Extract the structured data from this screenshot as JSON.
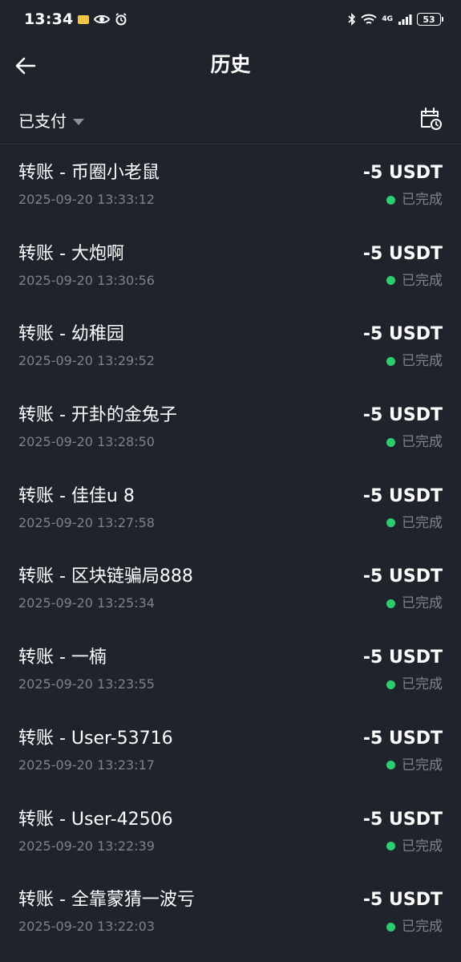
{
  "status_bar": {
    "time": "13:34",
    "network": "4G",
    "battery": "53",
    "icons": [
      "mail-icon",
      "eye-icon",
      "alarm-icon",
      "bluetooth-icon",
      "wifi-icon",
      "signal-icon",
      "battery-icon"
    ]
  },
  "header": {
    "title": "历史",
    "back_icon": "arrow-left-icon"
  },
  "filter": {
    "label": "已支付",
    "caret_icon": "caret-down-icon",
    "calendar_icon": "calendar-clock-icon"
  },
  "colors": {
    "background": "#1f242c",
    "text_primary": "#ffffff",
    "text_secondary": "#7d828b",
    "status_completed": "#2ecc71"
  },
  "transactions": [
    {
      "title": "转账 - 币圈小老鼠",
      "time": "2025-09-20 13:33:12",
      "amount": "-5 USDT",
      "status": "已完成"
    },
    {
      "title": "转账 - 大炮啊",
      "time": "2025-09-20 13:30:56",
      "amount": "-5 USDT",
      "status": "已完成"
    },
    {
      "title": "转账 - 幼稚园",
      "time": "2025-09-20 13:29:52",
      "amount": "-5 USDT",
      "status": "已完成"
    },
    {
      "title": "转账 - 开卦的金兔子",
      "time": "2025-09-20 13:28:50",
      "amount": "-5 USDT",
      "status": "已完成"
    },
    {
      "title": "转账 - 佳佳u 8",
      "time": "2025-09-20 13:27:58",
      "amount": "-5 USDT",
      "status": "已完成"
    },
    {
      "title": "转账 - 区块链骗局888",
      "time": "2025-09-20 13:25:34",
      "amount": "-5 USDT",
      "status": "已完成"
    },
    {
      "title": "转账 - 一楠",
      "time": "2025-09-20 13:23:55",
      "amount": "-5 USDT",
      "status": "已完成"
    },
    {
      "title": "转账 - User-53716",
      "time": "2025-09-20 13:23:17",
      "amount": "-5 USDT",
      "status": "已完成"
    },
    {
      "title": "转账 - User-42506",
      "time": "2025-09-20 13:22:39",
      "amount": "-5 USDT",
      "status": "已完成"
    },
    {
      "title": "转账 - 全靠蒙猜一波亏",
      "time": "2025-09-20 13:22:03",
      "amount": "-5 USDT",
      "status": "已完成"
    }
  ]
}
